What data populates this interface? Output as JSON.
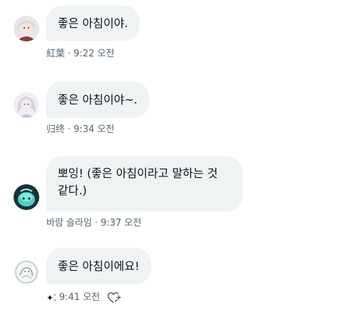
{
  "messages": [
    {
      "text": "좋은 아침이야.",
      "sender": "紅葉",
      "time": "9:22 오전",
      "avatar": "anime-character-avatar"
    },
    {
      "text": "좋은 아침이야~.",
      "sender": "归终",
      "time": "9:34 오전",
      "avatar": "anime-character-avatar"
    },
    {
      "text": "뽀잉! (좋은 아침이라고 말하는 것 같다.)",
      "sender": "바람 슬라임",
      "time": "9:37 오전",
      "avatar": "slime-avatar"
    },
    {
      "text": "좋은 아침이에요!",
      "sender": "✦⁚",
      "time": "9:41 오전",
      "avatar": "sketch-avatar",
      "reaction_icon": "heart-plus-icon"
    }
  ],
  "separator": "·",
  "colors": {
    "bubble": "#eff3f4",
    "meta_text": "#536471",
    "text": "#0f1419",
    "slime": "#4fd1c5"
  }
}
